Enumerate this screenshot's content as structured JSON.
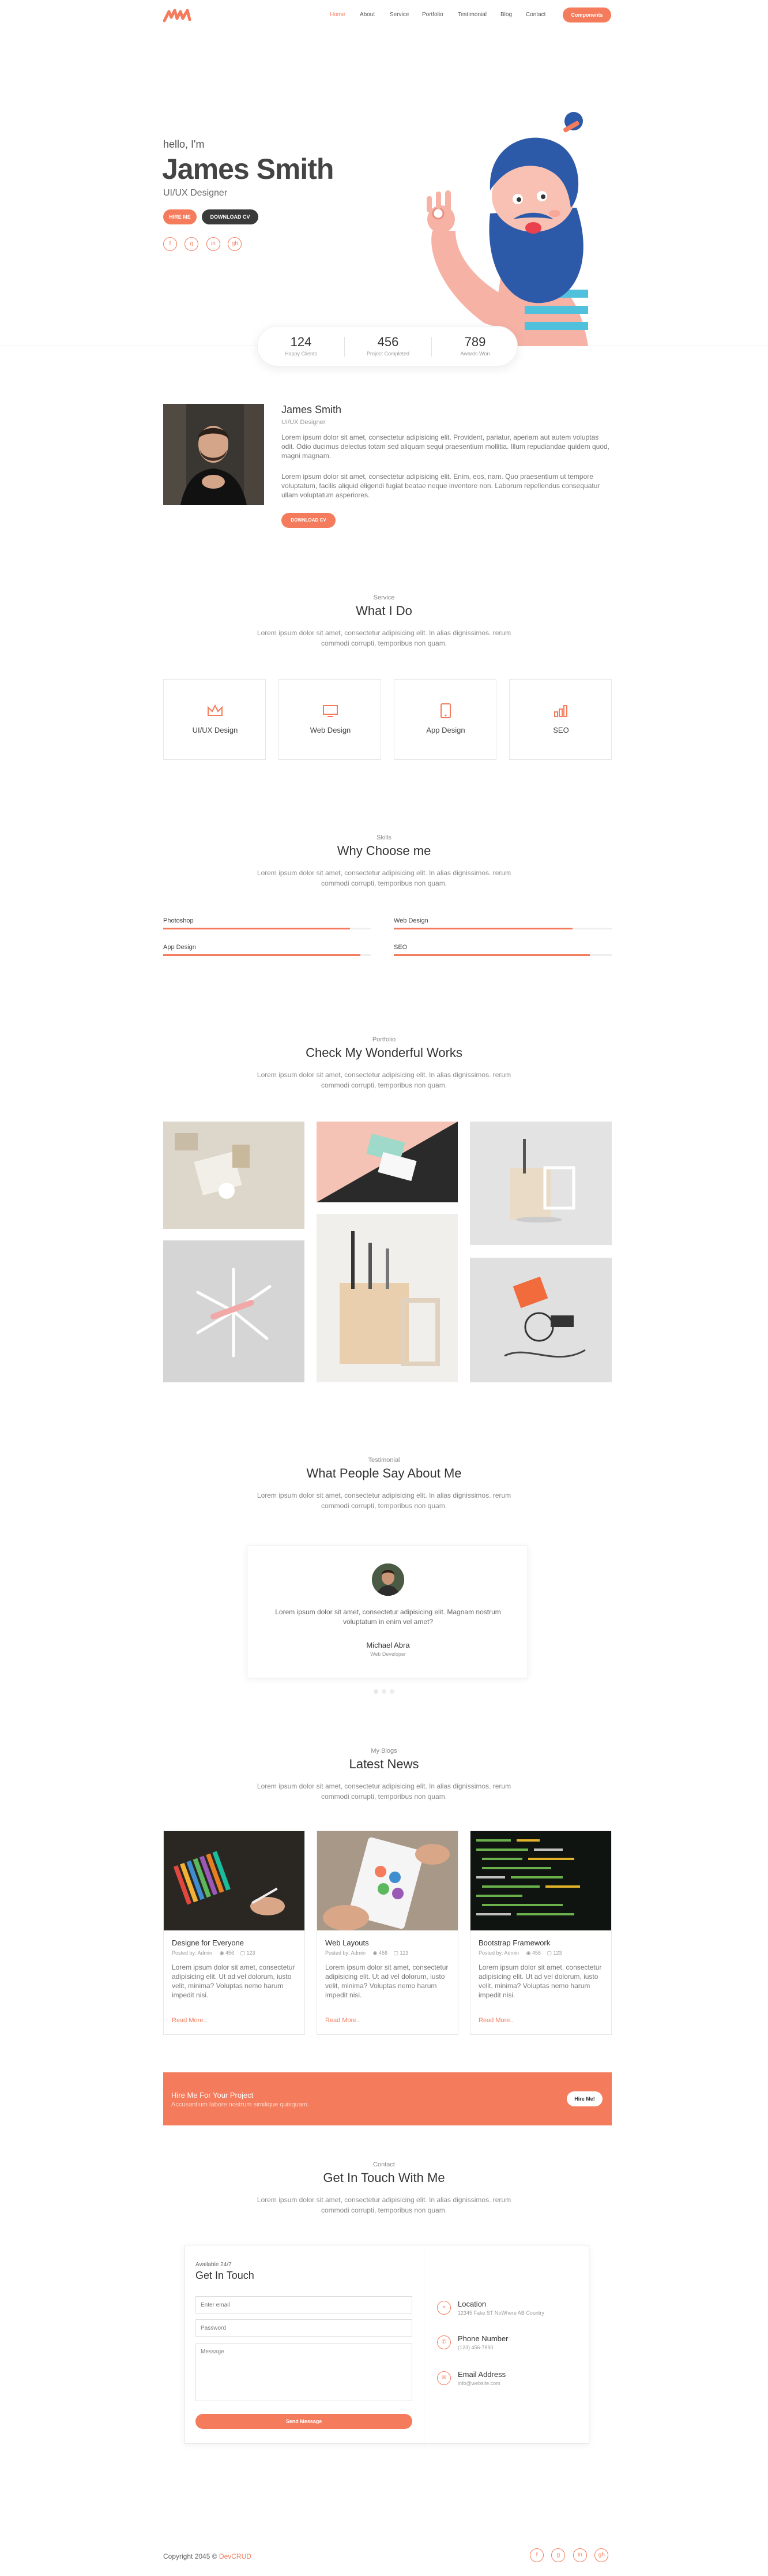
{
  "nav": {
    "items": [
      "Home",
      "About",
      "Service",
      "Portfolio",
      "Testimonial",
      "Blog",
      "Contact"
    ],
    "cta": "Components"
  },
  "hero": {
    "greeting": "hello, I'm",
    "name": "James Smith",
    "role": "UI/UX Designer",
    "hire_label": "HIRE ME",
    "download_label": "DOWNLOAD CV",
    "social_icons": [
      "facebook-icon",
      "google-plus-icon",
      "linkedin-icon",
      "github-icon"
    ]
  },
  "stats": [
    {
      "value": "124",
      "label": "Happy Clients"
    },
    {
      "value": "456",
      "label": "Project Completed"
    },
    {
      "value": "789",
      "label": "Awards Won"
    }
  ],
  "about": {
    "name": "James Smith",
    "role": "UI/UX Designer",
    "para1": "Lorem ipsum dolor sit amet, consectetur adipisicing elit. Provident, pariatur, aperiam aut autem voluptas odit. Odio ducimus delectus totam sed aliquam sequi praesentium mollitia. Illum repudiandae quidem quod, magni magnam.",
    "para2": "Lorem ipsum dolor sit amet, consectetur adipisicing elit. Enim, eos, nam. Quo praesentium ut tempore voluptatum, facilis aliquid eligendi fugiat beatae neque inventore non. Laborum repellendus consequatur ullam voluptatum asperiores.",
    "download_label": "DOWNLOAD CV"
  },
  "service": {
    "label": "Service",
    "title": "What I Do",
    "desc": "Lorem ipsum dolor sit amet, consectetur adipisicing elit. In alias dignissimos. rerum commodi corrupti, temporibus non quam.",
    "items": [
      {
        "name": "UI/UX Design",
        "icon": "crown-icon"
      },
      {
        "name": "Web Design",
        "icon": "monitor-icon"
      },
      {
        "name": "App Design",
        "icon": "tablet-icon"
      },
      {
        "name": "SEO",
        "icon": "bar-chart-icon"
      }
    ]
  },
  "skills": {
    "label": "Skills",
    "title": "Why Choose me",
    "desc": "Lorem ipsum dolor sit amet, consectetur adipisicing elit. In alias dignissimos. rerum commodi corrupti, temporibus non quam.",
    "items": [
      {
        "name": "Photoshop",
        "level": 0.9
      },
      {
        "name": "Web Design",
        "level": 0.82
      },
      {
        "name": "App Design",
        "level": 0.95
      },
      {
        "name": "SEO",
        "level": 0.9
      }
    ]
  },
  "portfolio": {
    "label": "Portfolio",
    "title": "Check My Wonderful Works",
    "desc": "Lorem ipsum dolor sit amet, consectetur adipisicing elit. In alias dignissimos. rerum commodi corrupti, temporibus non quam."
  },
  "testimonial": {
    "label": "Testimonial",
    "title": "What People Say About Me",
    "desc": "Lorem ipsum dolor sit amet, consectetur adipisicing elit. In alias dignissimos. rerum commodi corrupti, temporibus non quam.",
    "quote": "Lorem ipsum dolor sit amet, consectetur adipisicing elit. Magnam nostrum voluptatum in enim vel amet?",
    "author": "Michael Abra",
    "author_role": "Web Developer"
  },
  "blog": {
    "label": "My Blogs",
    "title": "Latest News",
    "desc": "Lorem ipsum dolor sit amet, consectetur adipisicing elit. In alias dignissimos. rerum commodi corrupti, temporibus non quam.",
    "posts": [
      {
        "title": "Designe for Everyone",
        "author": "Posted by: Admin",
        "views": "456",
        "comments": "123",
        "body": "Lorem ipsum dolor sit amet, consectetur adipisicing elit. Ut ad vel dolorum, iusto velit, minima? Voluptas nemo harum impedit nisi.",
        "more": "Read More.."
      },
      {
        "title": "Web Layouts",
        "author": "Posted by: Admin",
        "views": "456",
        "comments": "123",
        "body": "Lorem ipsum dolor sit amet, consectetur adipisicing elit. Ut ad vel dolorum, iusto velit, minima? Voluptas nemo harum impedit nisi.",
        "more": "Read More.."
      },
      {
        "title": "Bootstrap Framework",
        "author": "Posted by: Admin",
        "views": "456",
        "comments": "123",
        "body": "Lorem ipsum dolor sit amet, consectetur adipisicing elit. Ut ad vel dolorum, iusto velit, minima? Voluptas nemo harum impedit nisi.",
        "more": "Read More.."
      }
    ]
  },
  "hire": {
    "title": "Hire Me For Your Project",
    "subtitle": "Accusantium labore nostrum similique quisquam.",
    "button": "Hire Me!"
  },
  "contact": {
    "label": "Contact",
    "title": "Get In Touch With Me",
    "desc": "Lorem ipsum dolor sit amet, consectetur adipisicing elit. In alias dignissimos. rerum commodi corrupti, temporibus non quam.",
    "form_sub": "Available 24/7",
    "form_title": "Get In Touch",
    "email_placeholder": "Enter email",
    "password_placeholder": "Password",
    "message_placeholder": "Message",
    "send_label": "Send Message",
    "info": [
      {
        "title": "Location",
        "value": "12345 Fake ST NoWhere AB Country",
        "icon": "map-pin-icon"
      },
      {
        "title": "Phone Number",
        "value": "(123) 456-7890",
        "icon": "phone-icon"
      },
      {
        "title": "Email Address",
        "value": "info@website.com",
        "icon": "envelope-icon"
      }
    ]
  },
  "footer": {
    "copyright": "Copyright 2045 ©",
    "brand": "DevCRUD",
    "social_icons": [
      "facebook-icon",
      "google-plus-icon",
      "linkedin-icon",
      "github-icon"
    ]
  },
  "colors": {
    "accent": "#f47b5b",
    "dark": "#3a3a3a",
    "beard": "#2d5aa8"
  }
}
